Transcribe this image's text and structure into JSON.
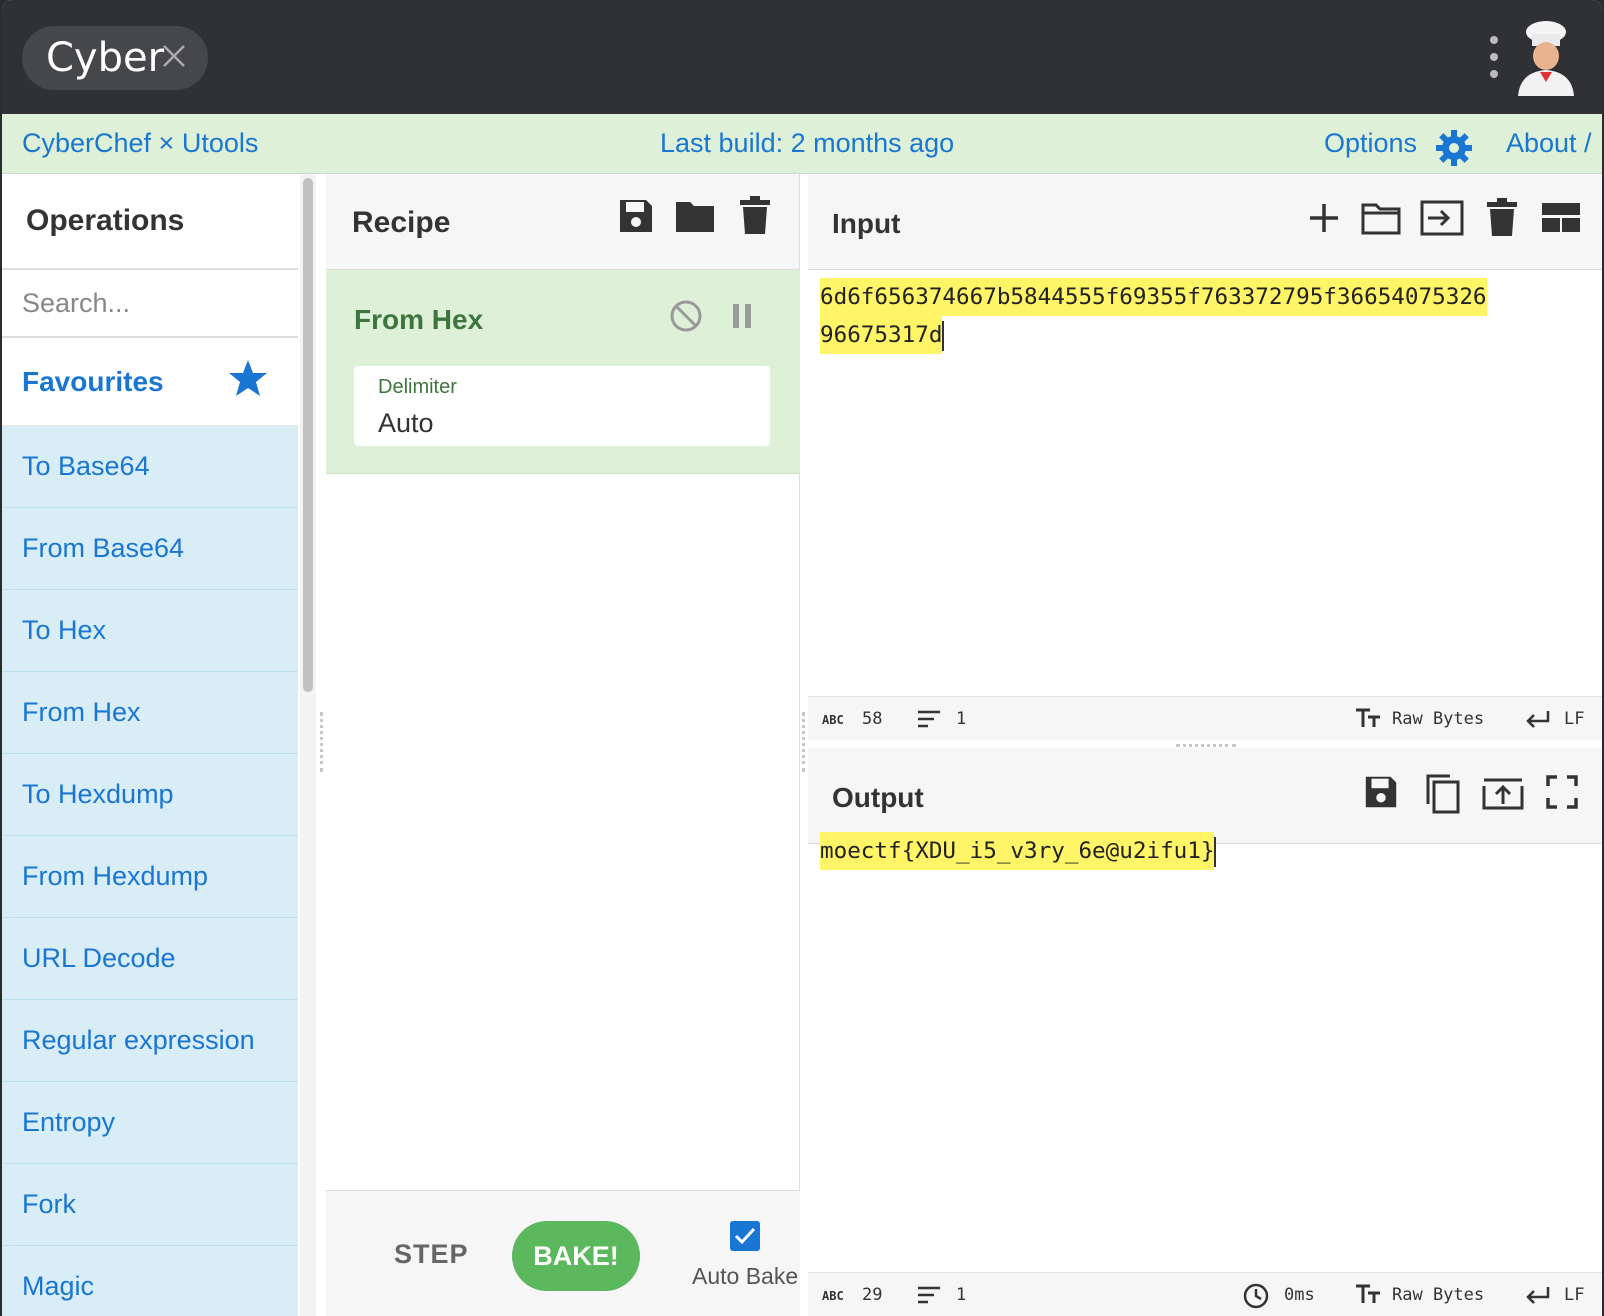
{
  "titlebar": {
    "tab_label": "Cyber",
    "tab_close_icon": "close-icon",
    "menu_icon": "kebab-menu-icon",
    "avatar_icon": "chef-avatar-icon"
  },
  "banner": {
    "brand": "CyberChef × Utools",
    "last_build": "Last build: 2 months ago",
    "options": "Options",
    "about": "About /"
  },
  "operations": {
    "title": "Operations",
    "search_placeholder": "Search...",
    "favourites_label": "Favourites",
    "items": [
      "To Base64",
      "From Base64",
      "To Hex",
      "From Hex",
      "To Hexdump",
      "From Hexdump",
      "URL Decode",
      "Regular expression",
      "Entropy",
      "Fork",
      "Magic"
    ]
  },
  "recipe": {
    "title": "Recipe",
    "operation": {
      "name": "From Hex",
      "arg_label": "Delimiter",
      "arg_value": "Auto"
    },
    "step_label": "STEP",
    "bake_label": "BAKE!",
    "auto_bake_label": "Auto Bake",
    "auto_bake_checked": true
  },
  "input": {
    "title": "Input",
    "line1": "6d6f656374667b5844555f69355f763372795f36654075326",
    "line2": "96675317d",
    "status": {
      "length": "58",
      "lines": "1",
      "encoding": "Raw Bytes",
      "eol": "LF"
    }
  },
  "output": {
    "title": "Output",
    "text": "moectf{XDU_i5_v3ry_6e@u2ifu1}",
    "status": {
      "length": "29",
      "lines": "1",
      "time": "0ms",
      "encoding": "Raw Bytes",
      "eol": "LF"
    }
  },
  "colors": {
    "accent": "#1976d2",
    "banner_bg": "#dff0d8",
    "favourite_bg": "#d9edf7",
    "bake": "#5cb85c",
    "highlight": "#fff566"
  }
}
